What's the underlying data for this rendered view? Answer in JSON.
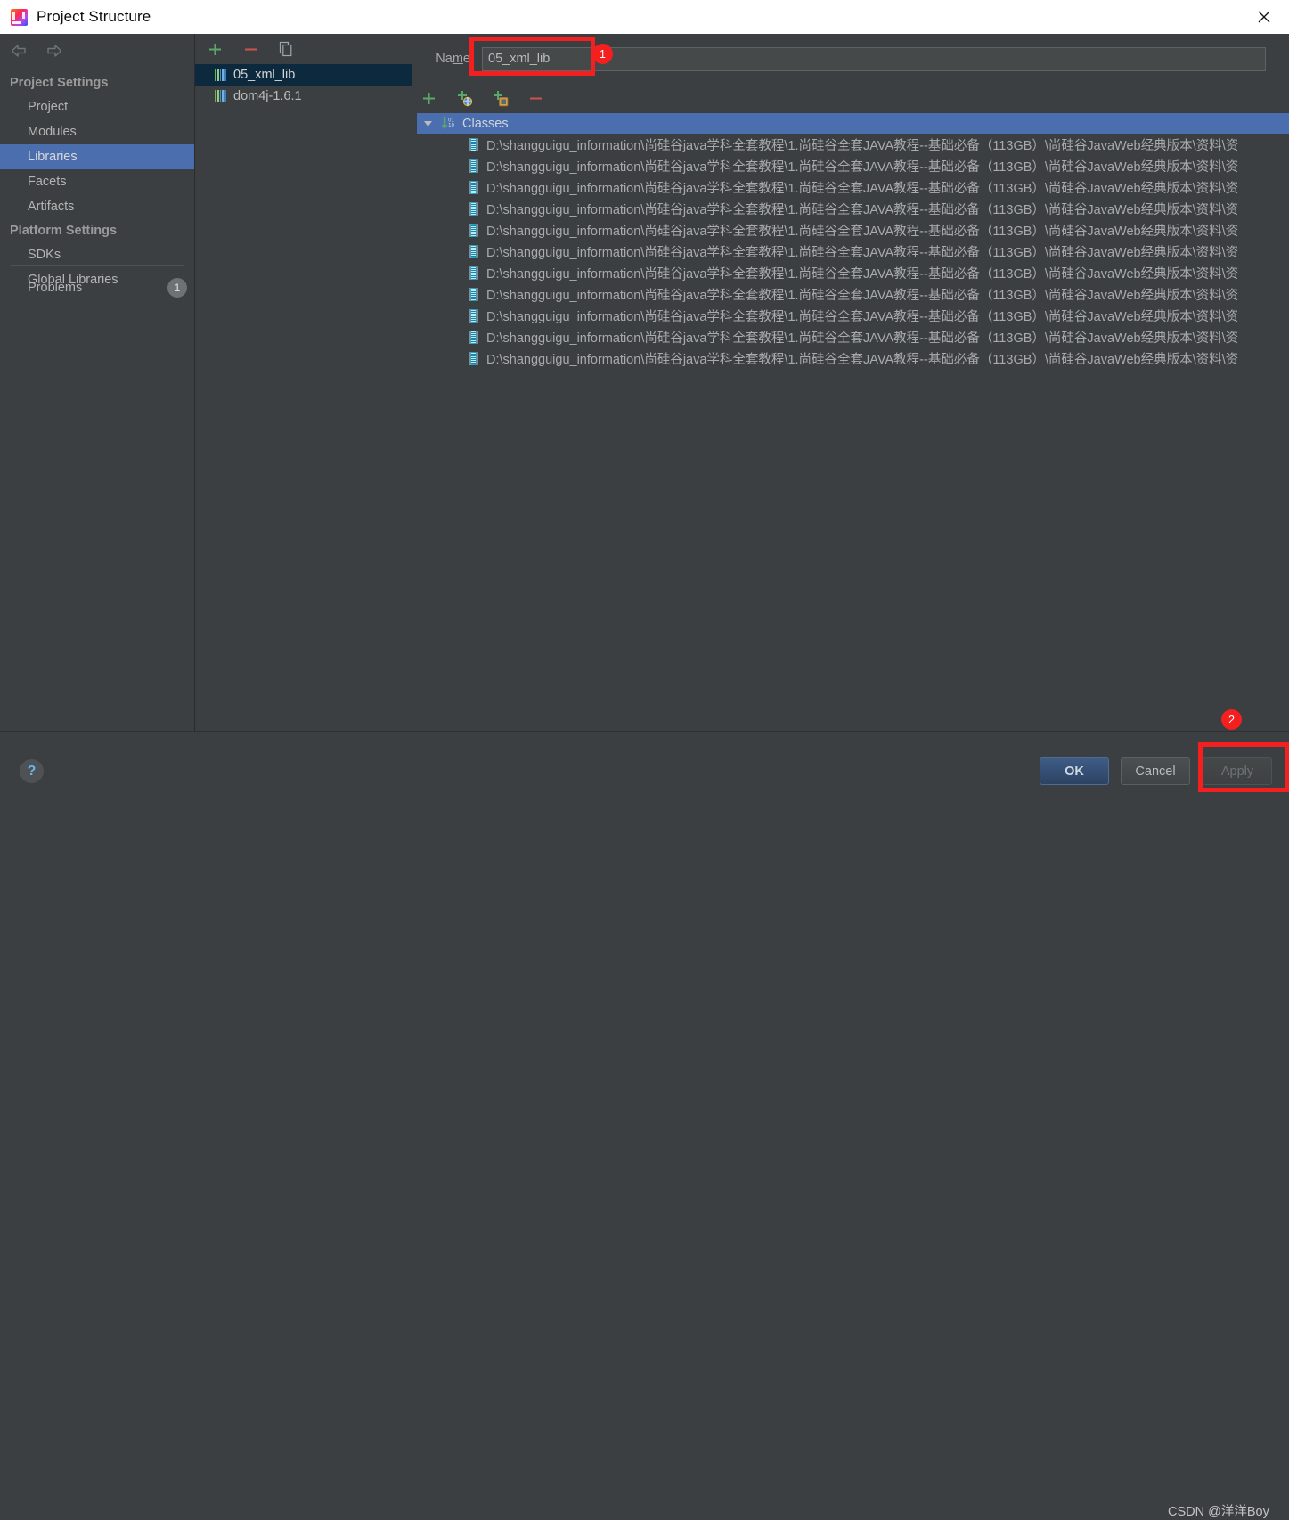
{
  "window": {
    "title": "Project Structure",
    "logo_icon": "intellij-idea-logo",
    "close_icon": "close-icon"
  },
  "sidebar": {
    "back_icon": "arrow-left-icon",
    "forward_icon": "arrow-right-icon",
    "groups": [
      {
        "title": "Project Settings",
        "items": [
          {
            "label": "Project",
            "selected": false
          },
          {
            "label": "Modules",
            "selected": false
          },
          {
            "label": "Libraries",
            "selected": true
          },
          {
            "label": "Facets",
            "selected": false
          },
          {
            "label": "Artifacts",
            "selected": false
          }
        ]
      },
      {
        "title": "Platform Settings",
        "items": [
          {
            "label": "SDKs",
            "selected": false
          },
          {
            "label": "Global Libraries",
            "selected": false
          }
        ]
      }
    ],
    "problems": {
      "label": "Problems",
      "count": "1"
    }
  },
  "library_panel": {
    "toolbar": [
      {
        "name": "add-library-button",
        "icon": "plus-icon"
      },
      {
        "name": "remove-library-button",
        "icon": "minus-icon"
      },
      {
        "name": "copy-library-button",
        "icon": "copy-icon"
      }
    ],
    "items": [
      {
        "label": "05_xml_lib",
        "icon": "library-icon",
        "selected": true
      },
      {
        "label": "dom4j-1.6.1",
        "icon": "library-icon",
        "selected": false
      }
    ]
  },
  "details": {
    "name_label_pre": "Na",
    "name_label_mnemonic": "m",
    "name_label_post": "e:",
    "name_value": "05_xml_lib",
    "name_placeholder": "",
    "toolbar": [
      {
        "name": "add-button",
        "icon": "plus-icon"
      },
      {
        "name": "add-from-maven-button",
        "icon": "plus-globe-icon"
      },
      {
        "name": "add-from-disk-button",
        "icon": "plus-archive-icon"
      },
      {
        "name": "remove-button",
        "icon": "minus-icon"
      }
    ],
    "tree": {
      "root": {
        "label": "Classes",
        "icon": "classes-binary-icon",
        "expander": "caret-down-icon",
        "expanded": true
      },
      "row_icon": "jar-archive-icon",
      "rows": [
        "D:\\shangguigu_information\\尚硅谷java学科全套教程\\1.尚硅谷全套JAVA教程--基础必备（113GB）\\尚硅谷JavaWeb经典版本\\资料\\资",
        "D:\\shangguigu_information\\尚硅谷java学科全套教程\\1.尚硅谷全套JAVA教程--基础必备（113GB）\\尚硅谷JavaWeb经典版本\\资料\\资",
        "D:\\shangguigu_information\\尚硅谷java学科全套教程\\1.尚硅谷全套JAVA教程--基础必备（113GB）\\尚硅谷JavaWeb经典版本\\资料\\资",
        "D:\\shangguigu_information\\尚硅谷java学科全套教程\\1.尚硅谷全套JAVA教程--基础必备（113GB）\\尚硅谷JavaWeb经典版本\\资料\\资",
        "D:\\shangguigu_information\\尚硅谷java学科全套教程\\1.尚硅谷全套JAVA教程--基础必备（113GB）\\尚硅谷JavaWeb经典版本\\资料\\资",
        "D:\\shangguigu_information\\尚硅谷java学科全套教程\\1.尚硅谷全套JAVA教程--基础必备（113GB）\\尚硅谷JavaWeb经典版本\\资料\\资",
        "D:\\shangguigu_information\\尚硅谷java学科全套教程\\1.尚硅谷全套JAVA教程--基础必备（113GB）\\尚硅谷JavaWeb经典版本\\资料\\资",
        "D:\\shangguigu_information\\尚硅谷java学科全套教程\\1.尚硅谷全套JAVA教程--基础必备（113GB）\\尚硅谷JavaWeb经典版本\\资料\\资",
        "D:\\shangguigu_information\\尚硅谷java学科全套教程\\1.尚硅谷全套JAVA教程--基础必备（113GB）\\尚硅谷JavaWeb经典版本\\资料\\资",
        "D:\\shangguigu_information\\尚硅谷java学科全套教程\\1.尚硅谷全套JAVA教程--基础必备（113GB）\\尚硅谷JavaWeb经典版本\\资料\\资",
        "D:\\shangguigu_information\\尚硅谷java学科全套教程\\1.尚硅谷全套JAVA教程--基础必备（113GB）\\尚硅谷JavaWeb经典版本\\资料\\资"
      ]
    }
  },
  "footer": {
    "help_icon": "help-question-icon",
    "help_label": "?",
    "ok_label": "OK",
    "cancel_label": "Cancel",
    "apply_label": "Apply"
  },
  "annotations": {
    "badge_1": "1",
    "badge_2": "2",
    "watermark": "CSDN @洋洋Boy"
  },
  "colors": {
    "selection_blue": "#4b6eaf",
    "list_selection": "#0d293e",
    "annotation_red": "#f42020",
    "panel_bg": "#3c3f41",
    "titlebar_bg": "#ffffff"
  }
}
